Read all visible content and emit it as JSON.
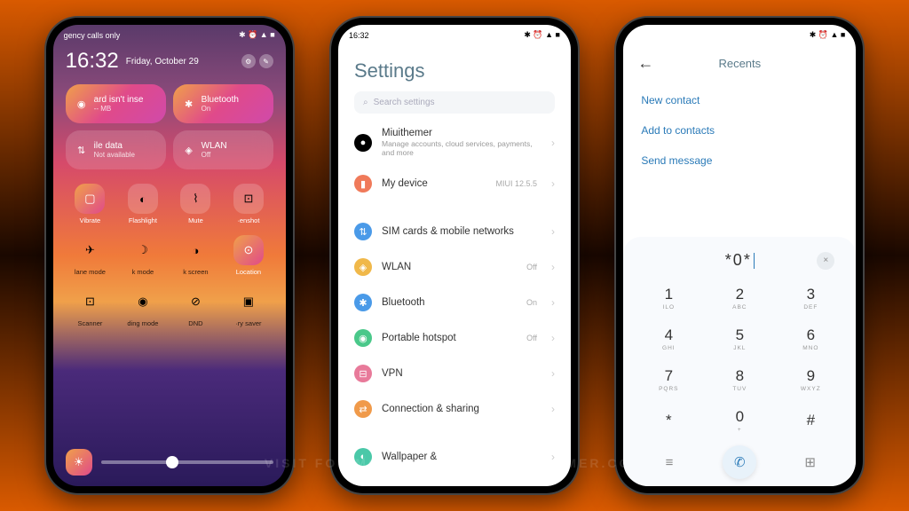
{
  "watermark": "Visit for more themes - miuithemer.com",
  "phone1": {
    "status_left": "gency calls only",
    "time": "16:32",
    "date": "Friday, October 29",
    "tiles": [
      {
        "name": "card-tile",
        "icon": "◉",
        "label": "ard isn't inse",
        "sub": "-- MB"
      },
      {
        "name": "bluetooth-tile",
        "icon": "✱",
        "label": "Bluetooth",
        "sub": "On"
      },
      {
        "name": "mobile-data-tile",
        "icon": "⇅",
        "label": "ile data",
        "sub": "Not available",
        "glass": true
      },
      {
        "name": "wlan-tile",
        "icon": "◈",
        "label": "WLAN",
        "sub": "Off",
        "glass": true
      }
    ],
    "small_tiles": [
      {
        "name": "vibrate-toggle",
        "icon": "▢",
        "label": "Vibrate",
        "active": true
      },
      {
        "name": "flashlight-toggle",
        "icon": "◐",
        "label": "Flashlight",
        "glass": true
      },
      {
        "name": "mute-toggle",
        "icon": "⌇",
        "label": "Mute",
        "glass": true
      },
      {
        "name": "screenshot-toggle",
        "icon": "⊡",
        "label": "·enshot",
        "glass": true
      },
      {
        "name": "airplane-toggle",
        "icon": "✈",
        "label": "lane mode",
        "dark": true
      },
      {
        "name": "dark-mode-toggle",
        "icon": "☽",
        "label": "k mode",
        "dark": true
      },
      {
        "name": "screen-toggle",
        "icon": "◑",
        "label": "k screen",
        "dark": true
      },
      {
        "name": "location-toggle",
        "icon": "⊙",
        "label": "Location",
        "active": true
      },
      {
        "name": "scanner-toggle",
        "icon": "⊡",
        "label": "Scanner",
        "dark": true
      },
      {
        "name": "reading-mode-toggle",
        "icon": "◉",
        "label": "ding mode",
        "dark": true
      },
      {
        "name": "dnd-toggle",
        "icon": "⊘",
        "label": "DND",
        "dark": true
      },
      {
        "name": "battery-saver-toggle",
        "icon": "▣",
        "label": "·ry saver",
        "dark": true
      }
    ]
  },
  "phone2": {
    "time": "16:32",
    "title": "Settings",
    "search_placeholder": "Search settings",
    "items": [
      {
        "name": "account-item",
        "icon_bg": "#000",
        "icon": "●",
        "label": "Miuithemer",
        "sub": "Manage accounts, cloud services, payments, and more"
      },
      {
        "name": "my-device-item",
        "icon_bg": "#f07a5a",
        "icon": "▮",
        "label": "My device",
        "val": "MIUI 12.5.5",
        "gap_after": true
      },
      {
        "name": "sim-item",
        "icon_bg": "#4a9ae8",
        "icon": "⇅",
        "label": "SIM cards & mobile networks"
      },
      {
        "name": "wlan-item",
        "icon_bg": "#f0b84a",
        "icon": "◈",
        "label": "WLAN",
        "val": "Off"
      },
      {
        "name": "bluetooth-item",
        "icon_bg": "#4a9ae8",
        "icon": "✱",
        "label": "Bluetooth",
        "val": "On"
      },
      {
        "name": "hotspot-item",
        "icon_bg": "#4ac88a",
        "icon": "◉",
        "label": "Portable hotspot",
        "val": "Off"
      },
      {
        "name": "vpn-item",
        "icon_bg": "#e87a9a",
        "icon": "⊟",
        "label": "VPN"
      },
      {
        "name": "connection-item",
        "icon_bg": "#f09a4a",
        "icon": "⇄",
        "label": "Connection & sharing",
        "gap_after": true
      },
      {
        "name": "wallpaper-item",
        "icon_bg": "#4ac8a8",
        "icon": "◐",
        "label": "Wallpaper &"
      }
    ]
  },
  "phone3": {
    "title": "Recents",
    "actions": [
      {
        "name": "new-contact-action",
        "label": "New contact"
      },
      {
        "name": "add-to-contacts-action",
        "label": "Add to contacts"
      },
      {
        "name": "send-message-action",
        "label": "Send message"
      }
    ],
    "dialed": "*0*",
    "keys": [
      {
        "num": "1",
        "let": "ILO"
      },
      {
        "num": "2",
        "let": "ABC"
      },
      {
        "num": "3",
        "let": "DEF"
      },
      {
        "num": "4",
        "let": "GHI"
      },
      {
        "num": "5",
        "let": "JKL"
      },
      {
        "num": "6",
        "let": "MNO"
      },
      {
        "num": "7",
        "let": "PQRS"
      },
      {
        "num": "8",
        "let": "TUV"
      },
      {
        "num": "9",
        "let": "WXYZ"
      },
      {
        "num": "*",
        "let": ""
      },
      {
        "num": "0",
        "let": "+"
      },
      {
        "num": "#",
        "let": ""
      }
    ]
  }
}
